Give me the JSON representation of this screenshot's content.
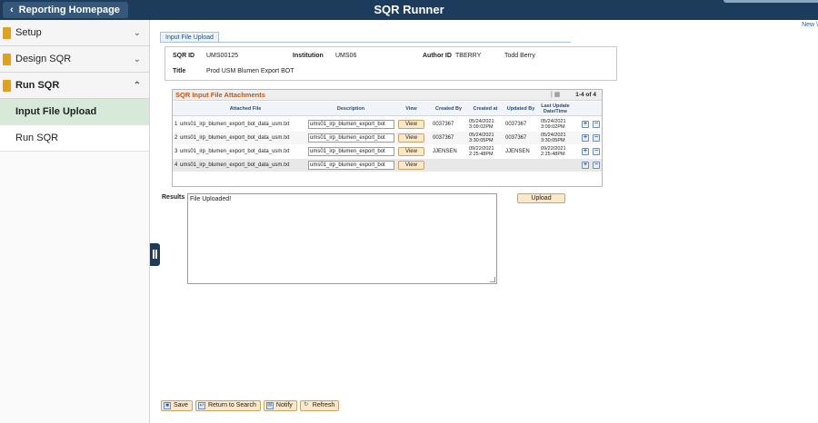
{
  "header": {
    "back_label": "Reporting Homepage",
    "title": "SQR Runner",
    "new_link": "New \\"
  },
  "sidebar": {
    "items": [
      {
        "label": "Setup",
        "icon": "folder-icon",
        "caret": "chevron-down"
      },
      {
        "label": "Design SQR",
        "icon": "folder-icon",
        "caret": "chevron-down"
      },
      {
        "label": "Run SQR",
        "icon": "folder-icon",
        "caret": "chevron-up"
      }
    ],
    "sub_items": [
      {
        "label": "Input File Upload",
        "active": true
      },
      {
        "label": "Run SQR",
        "active": false
      }
    ]
  },
  "tab": {
    "label": "Input File Upload"
  },
  "info": {
    "sqr_id_label": "SQR ID",
    "sqr_id": "UMS00125",
    "institution_label": "Institution",
    "institution": "UMS06",
    "author_label": "Author ID",
    "author_id": "TBERRY",
    "author_name": "Todd Berry",
    "title_label": "Title",
    "title": "Prod USM Blumen Export BOT"
  },
  "grid": {
    "title": "SQR Input File Attachments",
    "count": "1-4 of 4",
    "headers": {
      "file": "Attached File",
      "description": "Description",
      "view": "View",
      "created_by": "Created By",
      "created_at": "Created at",
      "updated_by": "Updated By",
      "last_update": "Last Update Date/Time"
    },
    "view_label": "View",
    "rows": [
      {
        "num": "1",
        "file": "ums01_irp_blumen_export_bot_data_usm.txt",
        "description": "ums01_irp_blumen_export_bot",
        "created_by": "0037367",
        "created_at": "05/24/2021 3:09:02PM",
        "updated_by": "0037367",
        "last_update": "05/24/2021 3:09:02PM"
      },
      {
        "num": "2",
        "file": "ums01_irp_blumen_export_bot_data_usm.txt",
        "description": "ums01_irp_blumen_export_bot",
        "created_by": "0037367",
        "created_at": "05/24/2021 3:30:05PM",
        "updated_by": "0037367",
        "last_update": "05/24/2021 3:30:05PM"
      },
      {
        "num": "3",
        "file": "ums01_irp_blumen_export_bot_data_usm.txt",
        "description": "ums01_irp_blumen_export_bot",
        "created_by": "JJENSEN",
        "created_at": "09/22/2021 2:25:48PM",
        "updated_by": "JJENSEN",
        "last_update": "09/22/2021 2:25:48PM"
      },
      {
        "num": "4",
        "file": "ums01_irp_blumen_export_bot_data_usm.txt",
        "description": "ums01_irp_blumen_export_bot",
        "created_by": "",
        "created_at": "",
        "updated_by": "",
        "last_update": ""
      }
    ]
  },
  "results": {
    "label": "Results",
    "value": "File Uploaded!"
  },
  "upload_label": "Upload",
  "toolbar": {
    "save": "Save",
    "return": "Return to Search",
    "notify": "Notify",
    "refresh": "Refresh"
  }
}
